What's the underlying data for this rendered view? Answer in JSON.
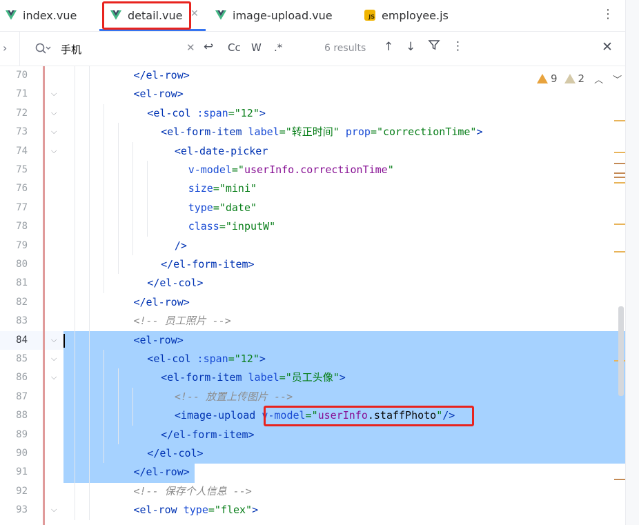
{
  "tabs": [
    {
      "label": "index.vue",
      "icon": "vue-icon"
    },
    {
      "label": "detail.vue",
      "icon": "vue-icon",
      "active": true
    },
    {
      "label": "image-upload.vue",
      "icon": "vue-icon"
    },
    {
      "label": "employee.js",
      "icon": "js-icon",
      "icon_text": "JS"
    }
  ],
  "search": {
    "query": "手机",
    "results": "6 results",
    "buttons": {
      "match_case": "Cc",
      "words": "W",
      "regex": ".*"
    }
  },
  "inspections": {
    "warnings": "9",
    "weak_warnings": "2"
  },
  "colors": {
    "accent": "#3574f0",
    "selection": "#a6d2ff",
    "annotation": "#e8231e",
    "warning": "#e8a33d"
  },
  "code_lines": [
    {
      "n": "70",
      "indent": 2,
      "text": "</el-row>"
    },
    {
      "n": "71",
      "indent": 2,
      "text": "<el-row>"
    },
    {
      "n": "72",
      "indent": 3,
      "text": "<el-col :span=\"12\">"
    },
    {
      "n": "73",
      "indent": 4,
      "text": "<el-form-item label=\"转正时间\" prop=\"correctionTime\">"
    },
    {
      "n": "74",
      "indent": 5,
      "text": "<el-date-picker"
    },
    {
      "n": "75",
      "indent": 6,
      "text": "v-model=\"userInfo.correctionTime\""
    },
    {
      "n": "76",
      "indent": 6,
      "text": "size=\"mini\""
    },
    {
      "n": "77",
      "indent": 6,
      "text": "type=\"date\""
    },
    {
      "n": "78",
      "indent": 6,
      "text": "class=\"inputW\""
    },
    {
      "n": "79",
      "indent": 5,
      "text": "/>"
    },
    {
      "n": "80",
      "indent": 4,
      "text": "</el-form-item>"
    },
    {
      "n": "81",
      "indent": 3,
      "text": "</el-col>"
    },
    {
      "n": "82",
      "indent": 2,
      "text": "</el-row>"
    },
    {
      "n": "83",
      "indent": 2,
      "text": "<!-- 员工照片 -->"
    },
    {
      "n": "84",
      "indent": 2,
      "text": "<el-row>"
    },
    {
      "n": "85",
      "indent": 3,
      "text": "<el-col :span=\"12\">"
    },
    {
      "n": "86",
      "indent": 4,
      "text": "<el-form-item label=\"员工头像\">"
    },
    {
      "n": "87",
      "indent": 5,
      "text": "<!-- 放置上传图片 -->"
    },
    {
      "n": "88",
      "indent": 5,
      "text": "<image-upload v-model=\"userInfo.staffPhoto\"/>"
    },
    {
      "n": "89",
      "indent": 4,
      "text": "</el-form-item>"
    },
    {
      "n": "90",
      "indent": 3,
      "text": "</el-col>"
    },
    {
      "n": "91",
      "indent": 2,
      "text": "</el-row>"
    },
    {
      "n": "92",
      "indent": 2,
      "text": "<!-- 保存个人信息 -->"
    },
    {
      "n": "93",
      "indent": 2,
      "text": "<el-row type=\"flex\">"
    }
  ]
}
